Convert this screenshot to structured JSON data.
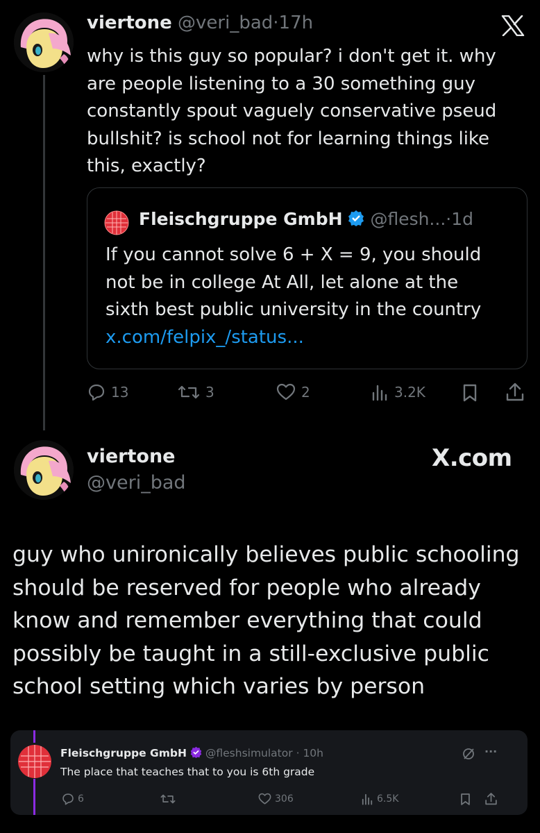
{
  "tweet1": {
    "name": "viertone",
    "handle": "@veri_bad",
    "separator": "·",
    "time": "17h",
    "lines": [
      "why is this guy so popular? i don't get it. why",
      "are people listening to a 30 something guy",
      "constantly spout vaguely conservative pseud",
      "bullshit? is school not for learning things like",
      "this, exactly?"
    ],
    "quote": {
      "name": "Fleischgruppe GmbH",
      "handle": "@flesh...",
      "separator": "·",
      "time": "1d",
      "lines": [
        "If you cannot solve 6 + X = 9, you should",
        "not be in college At All, let alone at the",
        "sixth best public university in the country"
      ],
      "link": "x.com/felpix_/status..."
    },
    "actions": {
      "replies": "13",
      "reposts": "3",
      "likes": "2",
      "views": "3.2K"
    }
  },
  "tweet2": {
    "name": "viertone",
    "handle": "@veri_bad",
    "brand": "X.com",
    "lines": [
      "guy who unironically believes public schooling",
      "should be reserved for people who already",
      "know and remember everything that could",
      "possibly be taught in a still-exclusive public",
      "school setting which varies by person"
    ]
  },
  "reply": {
    "name": "Fleischgruppe GmbH",
    "handle": "@fleshsimulator",
    "separator": "·",
    "time": "10h",
    "text": "The place that teaches that to you is 6th grade",
    "more": "···",
    "actions": {
      "replies": "6",
      "likes": "306",
      "views": "6.5K"
    }
  },
  "colors": {
    "background": "#000000",
    "text": "#e7e9ea",
    "muted": "#71767b",
    "link": "#1d9bf0",
    "verified": "#1d9bf0",
    "thread_accent": "#8b2be2"
  },
  "icons": [
    "x-logo-icon",
    "verified-badge-icon",
    "reply-icon",
    "repost-icon",
    "like-icon",
    "views-icon",
    "bookmark-icon",
    "share-icon",
    "grok-icon",
    "more-icon"
  ]
}
